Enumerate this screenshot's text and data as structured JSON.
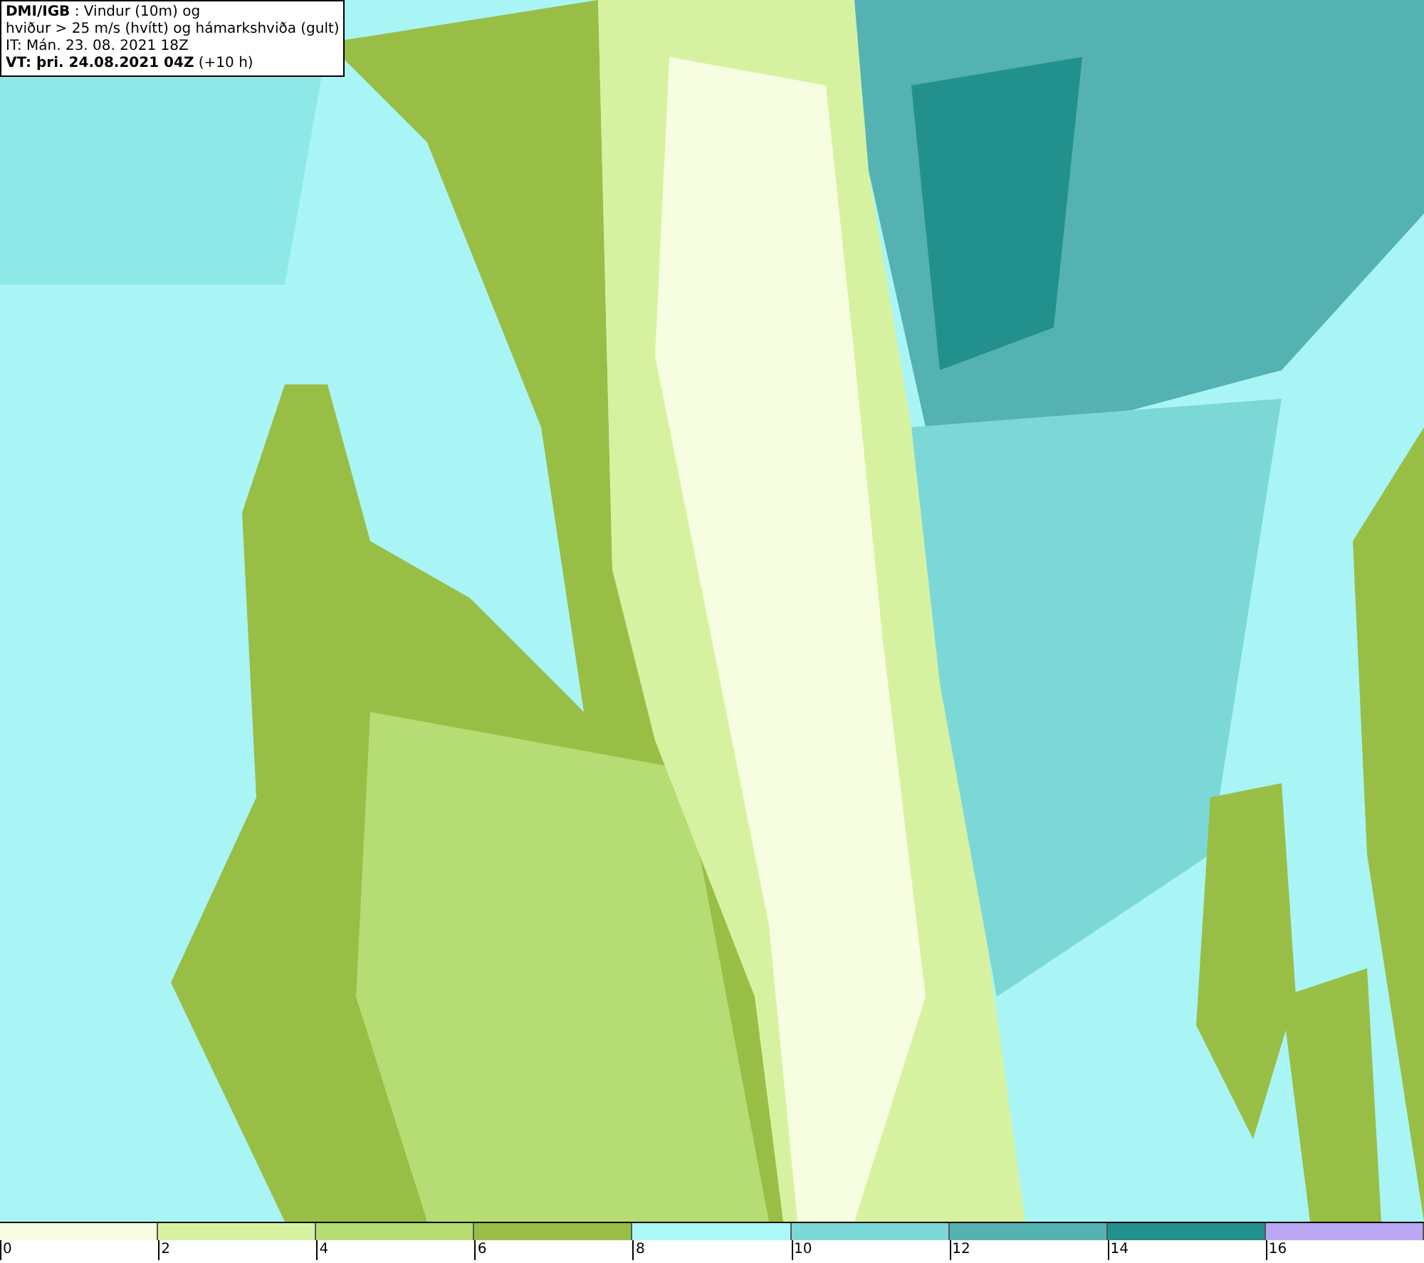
{
  "info_box": {
    "lines": [
      "**DMI/IGB** : Vindur (10m) og",
      "hviður > 25 m/s (hvítt) og hámarkshviða (gult)",
      "IT: Mán. 23. 08. 2021 18Z",
      "**VT: þri. 24.08.2021 04Z** (+10 h)"
    ]
  },
  "legend": [
    {
      "label": "0",
      "color": "#f7fde0"
    },
    {
      "label": "2",
      "color": "#d6f2a0"
    },
    {
      "label": "4",
      "color": "#b6dc74"
    },
    {
      "label": "6",
      "color": "#98be46"
    },
    {
      "label": "8",
      "color": "#aaf8f8"
    },
    {
      "label": "10",
      "color": "#7cd8d6"
    },
    {
      "label": "12",
      "color": "#54b2b2"
    },
    {
      "label": "14",
      "color": "#22908c"
    },
    {
      "label": "16",
      "color": "#bba8f4"
    }
  ]
}
